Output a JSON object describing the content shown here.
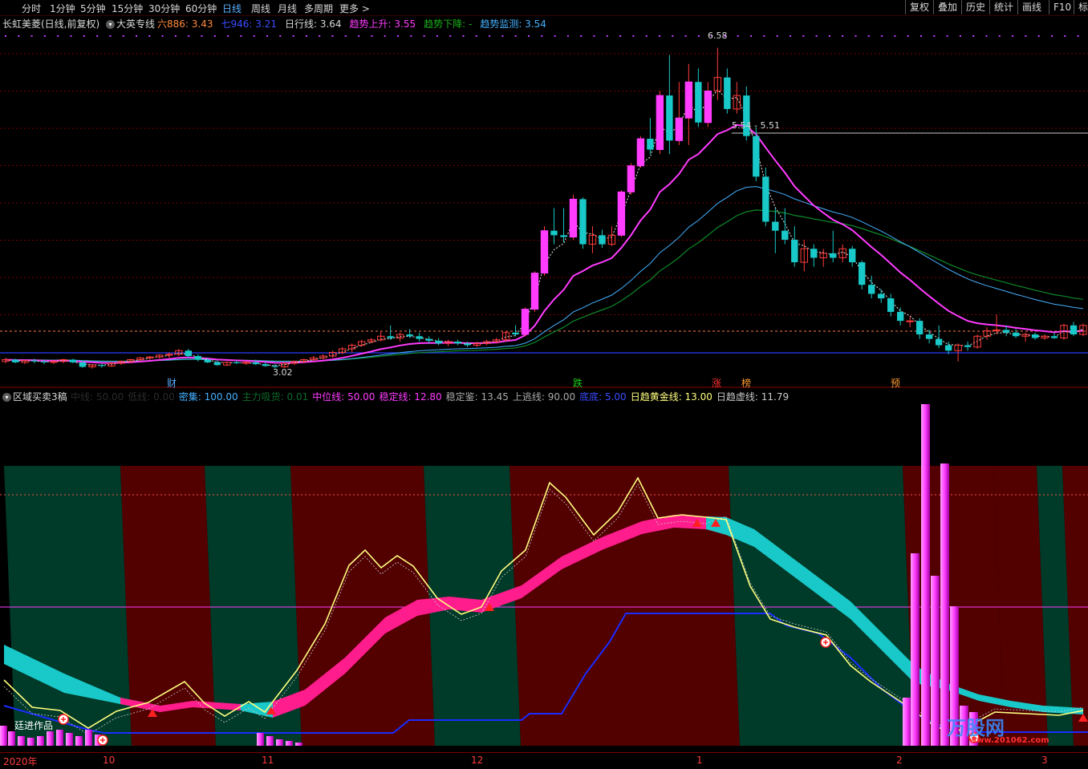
{
  "toolbar": {
    "tabs": [
      "分时",
      "1分钟",
      "5分钟",
      "15分钟",
      "30分钟",
      "60分钟",
      "日线",
      "周线",
      "月线",
      "多周期",
      "更多 >"
    ],
    "active": "日线",
    "right_buttons": [
      "复权",
      "叠加",
      "历史",
      "统计",
      "画线",
      "F10",
      "标"
    ]
  },
  "main_header": {
    "stock": "长虹美菱(日线,前复权)",
    "indicator": "大英专线",
    "items": [
      {
        "label": "六886: 3.43",
        "color": "#ff8a3c"
      },
      {
        "label": "七946: 3.21",
        "color": "#3a4cff"
      },
      {
        "label": "日行线: 3.64",
        "color": "#d8d8d8"
      },
      {
        "label": "趋势上升: 3.55",
        "color": "#ff3cff"
      },
      {
        "label": "趋势下降: -",
        "color": "#19b019"
      },
      {
        "label": "趋势监测: 3.54",
        "color": "#45b0ff"
      }
    ]
  },
  "annotations": {
    "high": "6.58",
    "low": "3.02",
    "level": "5.54 - 5.51"
  },
  "signals": [
    {
      "text": "财",
      "color": "#5ab0ff"
    },
    {
      "text": "跌",
      "color": "#19d019"
    },
    {
      "text": "涨",
      "color": "#ff3030"
    },
    {
      "text": "榜",
      "color": "#ff9a30"
    },
    {
      "text": "预",
      "color": "#ff9a30"
    }
  ],
  "sub_header": {
    "indicator": "区域买卖3稿",
    "items": [
      {
        "label": "中线: 50.00",
        "color": "#2a2a2a"
      },
      {
        "label": "低线: 0.00",
        "color": "#2a2a2a"
      },
      {
        "label": "密集: 100.00",
        "color": "#45b0ff"
      },
      {
        "label": "主力吸货: 0.01",
        "color": "#0d6a2a"
      },
      {
        "label": "中位线: 50.00",
        "color": "#ff3cff"
      },
      {
        "label": "稳定线: 12.80",
        "color": "#ff3cff"
      },
      {
        "label": "稳定鉴: 13.45",
        "color": "#a8a8a8"
      },
      {
        "label": "上逃线: 90.00",
        "color": "#a8a8a8"
      },
      {
        "label": "底底: 5.00",
        "color": "#3a4cff"
      },
      {
        "label": "日趋黄金线: 13.00",
        "color": "#ffff80"
      },
      {
        "label": "日趋虚线: 11.79",
        "color": "#c8c8c8"
      }
    ]
  },
  "watermark": {
    "author": "廷进作品",
    "brand": "万股网",
    "url": "www.201062.com"
  },
  "bottom_axis": [
    "2020年",
    "10",
    "11",
    "12",
    "1",
    "2",
    "3"
  ],
  "chart_data": {
    "type": "candlestick",
    "title": "长虹美菱(日线,前复权)",
    "y_range": [
      3.0,
      6.7
    ],
    "high": 6.58,
    "low": 3.02,
    "candles": [
      {
        "o": 3.1,
        "h": 3.14,
        "l": 3.08,
        "c": 3.12
      },
      {
        "o": 3.12,
        "h": 3.13,
        "l": 3.08,
        "c": 3.09
      },
      {
        "o": 3.09,
        "h": 3.12,
        "l": 3.07,
        "c": 3.11
      },
      {
        "o": 3.11,
        "h": 3.13,
        "l": 3.08,
        "c": 3.1
      },
      {
        "o": 3.1,
        "h": 3.12,
        "l": 3.07,
        "c": 3.09
      },
      {
        "o": 3.09,
        "h": 3.11,
        "l": 3.07,
        "c": 3.1
      },
      {
        "o": 3.1,
        "h": 3.13,
        "l": 3.08,
        "c": 3.12
      },
      {
        "o": 3.12,
        "h": 3.13,
        "l": 3.08,
        "c": 3.09
      },
      {
        "o": 3.09,
        "h": 3.11,
        "l": 3.03,
        "c": 3.04
      },
      {
        "o": 3.04,
        "h": 3.07,
        "l": 3.02,
        "c": 3.06
      },
      {
        "o": 3.06,
        "h": 3.08,
        "l": 3.03,
        "c": 3.05
      },
      {
        "o": 3.05,
        "h": 3.09,
        "l": 3.04,
        "c": 3.08
      },
      {
        "o": 3.08,
        "h": 3.11,
        "l": 3.06,
        "c": 3.1
      },
      {
        "o": 3.1,
        "h": 3.13,
        "l": 3.08,
        "c": 3.12
      },
      {
        "o": 3.12,
        "h": 3.15,
        "l": 3.1,
        "c": 3.14
      },
      {
        "o": 3.14,
        "h": 3.16,
        "l": 3.12,
        "c": 3.15
      },
      {
        "o": 3.15,
        "h": 3.18,
        "l": 3.13,
        "c": 3.17
      },
      {
        "o": 3.17,
        "h": 3.2,
        "l": 3.14,
        "c": 3.18
      },
      {
        "o": 3.18,
        "h": 3.24,
        "l": 3.16,
        "c": 3.22
      },
      {
        "o": 3.22,
        "h": 3.24,
        "l": 3.14,
        "c": 3.16
      },
      {
        "o": 3.16,
        "h": 3.18,
        "l": 3.1,
        "c": 3.12
      },
      {
        "o": 3.12,
        "h": 3.14,
        "l": 3.08,
        "c": 3.09
      },
      {
        "o": 3.09,
        "h": 3.11,
        "l": 3.05,
        "c": 3.06
      },
      {
        "o": 3.06,
        "h": 3.1,
        "l": 3.05,
        "c": 3.09
      },
      {
        "o": 3.09,
        "h": 3.11,
        "l": 3.07,
        "c": 3.08
      },
      {
        "o": 3.08,
        "h": 3.1,
        "l": 3.06,
        "c": 3.09
      },
      {
        "o": 3.09,
        "h": 3.12,
        "l": 3.06,
        "c": 3.07
      },
      {
        "o": 3.07,
        "h": 3.09,
        "l": 3.04,
        "c": 3.05
      },
      {
        "o": 3.05,
        "h": 3.07,
        "l": 3.02,
        "c": 3.04
      },
      {
        "o": 3.04,
        "h": 3.09,
        "l": 3.03,
        "c": 3.08
      },
      {
        "o": 3.08,
        "h": 3.11,
        "l": 3.06,
        "c": 3.1
      },
      {
        "o": 3.1,
        "h": 3.13,
        "l": 3.08,
        "c": 3.12
      },
      {
        "o": 3.12,
        "h": 3.16,
        "l": 3.1,
        "c": 3.14
      },
      {
        "o": 3.14,
        "h": 3.18,
        "l": 3.12,
        "c": 3.16
      },
      {
        "o": 3.16,
        "h": 3.22,
        "l": 3.14,
        "c": 3.2
      },
      {
        "o": 3.2,
        "h": 3.26,
        "l": 3.18,
        "c": 3.24
      },
      {
        "o": 3.24,
        "h": 3.3,
        "l": 3.2,
        "c": 3.28
      },
      {
        "o": 3.28,
        "h": 3.34,
        "l": 3.26,
        "c": 3.32
      },
      {
        "o": 3.32,
        "h": 3.36,
        "l": 3.3,
        "c": 3.34
      },
      {
        "o": 3.34,
        "h": 3.44,
        "l": 3.32,
        "c": 3.38
      },
      {
        "o": 3.38,
        "h": 3.5,
        "l": 3.34,
        "c": 3.36
      },
      {
        "o": 3.36,
        "h": 3.42,
        "l": 3.32,
        "c": 3.4
      },
      {
        "o": 3.4,
        "h": 3.46,
        "l": 3.36,
        "c": 3.38
      },
      {
        "o": 3.38,
        "h": 3.42,
        "l": 3.32,
        "c": 3.35
      },
      {
        "o": 3.35,
        "h": 3.38,
        "l": 3.3,
        "c": 3.33
      },
      {
        "o": 3.33,
        "h": 3.36,
        "l": 3.28,
        "c": 3.3
      },
      {
        "o": 3.3,
        "h": 3.34,
        "l": 3.27,
        "c": 3.32
      },
      {
        "o": 3.32,
        "h": 3.34,
        "l": 3.28,
        "c": 3.3
      },
      {
        "o": 3.3,
        "h": 3.32,
        "l": 3.26,
        "c": 3.28
      },
      {
        "o": 3.28,
        "h": 3.32,
        "l": 3.26,
        "c": 3.3
      },
      {
        "o": 3.3,
        "h": 3.34,
        "l": 3.28,
        "c": 3.32
      },
      {
        "o": 3.32,
        "h": 3.36,
        "l": 3.3,
        "c": 3.34
      },
      {
        "o": 3.34,
        "h": 3.44,
        "l": 3.32,
        "c": 3.42
      },
      {
        "o": 3.42,
        "h": 3.5,
        "l": 3.38,
        "c": 3.4
      },
      {
        "o": 3.4,
        "h": 3.7,
        "l": 3.38,
        "c": 3.68
      },
      {
        "o": 3.68,
        "h": 4.1,
        "l": 3.65,
        "c": 4.08
      },
      {
        "o": 4.08,
        "h": 4.6,
        "l": 4.05,
        "c": 4.55
      },
      {
        "o": 4.55,
        "h": 4.8,
        "l": 4.4,
        "c": 4.5
      },
      {
        "o": 4.5,
        "h": 4.8,
        "l": 4.42,
        "c": 4.48
      },
      {
        "o": 4.48,
        "h": 4.95,
        "l": 4.45,
        "c": 4.9
      },
      {
        "o": 4.9,
        "h": 4.92,
        "l": 4.35,
        "c": 4.4
      },
      {
        "o": 4.4,
        "h": 4.6,
        "l": 4.3,
        "c": 4.5
      },
      {
        "o": 4.5,
        "h": 4.56,
        "l": 4.36,
        "c": 4.4
      },
      {
        "o": 4.4,
        "h": 4.6,
        "l": 4.38,
        "c": 4.5
      },
      {
        "o": 4.5,
        "h": 5.0,
        "l": 4.48,
        "c": 4.98
      },
      {
        "o": 4.98,
        "h": 5.3,
        "l": 4.95,
        "c": 5.27
      },
      {
        "o": 5.27,
        "h": 5.6,
        "l": 5.25,
        "c": 5.57
      },
      {
        "o": 5.57,
        "h": 5.8,
        "l": 5.4,
        "c": 5.45
      },
      {
        "o": 5.45,
        "h": 6.1,
        "l": 5.4,
        "c": 6.05
      },
      {
        "o": 6.05,
        "h": 6.5,
        "l": 5.4,
        "c": 5.55
      },
      {
        "o": 5.55,
        "h": 6.2,
        "l": 5.5,
        "c": 5.8
      },
      {
        "o": 5.8,
        "h": 6.4,
        "l": 5.5,
        "c": 6.2
      },
      {
        "o": 6.2,
        "h": 6.35,
        "l": 5.7,
        "c": 5.75
      },
      {
        "o": 5.75,
        "h": 6.2,
        "l": 5.7,
        "c": 6.1
      },
      {
        "o": 6.1,
        "h": 6.58,
        "l": 6.0,
        "c": 6.25
      },
      {
        "o": 6.25,
        "h": 6.35,
        "l": 5.85,
        "c": 5.9
      },
      {
        "o": 5.9,
        "h": 6.2,
        "l": 5.85,
        "c": 6.05
      },
      {
        "o": 6.05,
        "h": 6.15,
        "l": 5.55,
        "c": 5.6
      },
      {
        "o": 5.6,
        "h": 5.7,
        "l": 5.1,
        "c": 5.15
      },
      {
        "o": 5.15,
        "h": 5.25,
        "l": 4.6,
        "c": 4.65
      },
      {
        "o": 4.65,
        "h": 4.8,
        "l": 4.3,
        "c": 4.55
      },
      {
        "o": 4.55,
        "h": 4.8,
        "l": 4.4,
        "c": 4.45
      },
      {
        "o": 4.45,
        "h": 4.6,
        "l": 4.15,
        "c": 4.2
      },
      {
        "o": 4.2,
        "h": 4.45,
        "l": 4.1,
        "c": 4.35
      },
      {
        "o": 4.35,
        "h": 4.4,
        "l": 4.15,
        "c": 4.25
      },
      {
        "o": 4.25,
        "h": 4.35,
        "l": 4.15,
        "c": 4.3
      },
      {
        "o": 4.3,
        "h": 4.55,
        "l": 4.2,
        "c": 4.25
      },
      {
        "o": 4.25,
        "h": 4.4,
        "l": 4.2,
        "c": 4.35
      },
      {
        "o": 4.35,
        "h": 4.38,
        "l": 4.15,
        "c": 4.2
      },
      {
        "o": 4.2,
        "h": 4.22,
        "l": 3.9,
        "c": 3.95
      },
      {
        "o": 3.95,
        "h": 4.05,
        "l": 3.8,
        "c": 3.85
      },
      {
        "o": 3.85,
        "h": 3.9,
        "l": 3.75,
        "c": 3.8
      },
      {
        "o": 3.8,
        "h": 3.85,
        "l": 3.6,
        "c": 3.65
      },
      {
        "o": 3.65,
        "h": 3.7,
        "l": 3.5,
        "c": 3.55
      },
      {
        "o": 3.55,
        "h": 3.6,
        "l": 3.48,
        "c": 3.55
      },
      {
        "o": 3.55,
        "h": 3.58,
        "l": 3.35,
        "c": 3.4
      },
      {
        "o": 3.4,
        "h": 3.45,
        "l": 3.3,
        "c": 3.35
      },
      {
        "o": 3.35,
        "h": 3.5,
        "l": 3.25,
        "c": 3.28
      },
      {
        "o": 3.28,
        "h": 3.32,
        "l": 3.18,
        "c": 3.22
      },
      {
        "o": 3.22,
        "h": 3.3,
        "l": 3.1,
        "c": 3.28
      },
      {
        "o": 3.28,
        "h": 3.32,
        "l": 3.22,
        "c": 3.26
      },
      {
        "o": 3.26,
        "h": 3.4,
        "l": 3.24,
        "c": 3.38
      },
      {
        "o": 3.38,
        "h": 3.48,
        "l": 3.34,
        "c": 3.44
      },
      {
        "o": 3.44,
        "h": 3.62,
        "l": 3.4,
        "c": 3.45
      },
      {
        "o": 3.45,
        "h": 3.5,
        "l": 3.38,
        "c": 3.42
      },
      {
        "o": 3.42,
        "h": 3.46,
        "l": 3.36,
        "c": 3.38
      },
      {
        "o": 3.38,
        "h": 3.42,
        "l": 3.32,
        "c": 3.4
      },
      {
        "o": 3.4,
        "h": 3.42,
        "l": 3.34,
        "c": 3.36
      },
      {
        "o": 3.36,
        "h": 3.4,
        "l": 3.34,
        "c": 3.38
      },
      {
        "o": 3.38,
        "h": 3.42,
        "l": 3.35,
        "c": 3.36
      },
      {
        "o": 3.36,
        "h": 3.52,
        "l": 3.34,
        "c": 3.5
      },
      {
        "o": 3.5,
        "h": 3.54,
        "l": 3.38,
        "c": 3.4
      },
      {
        "o": 3.4,
        "h": 3.52,
        "l": 3.38,
        "c": 3.5
      }
    ]
  }
}
